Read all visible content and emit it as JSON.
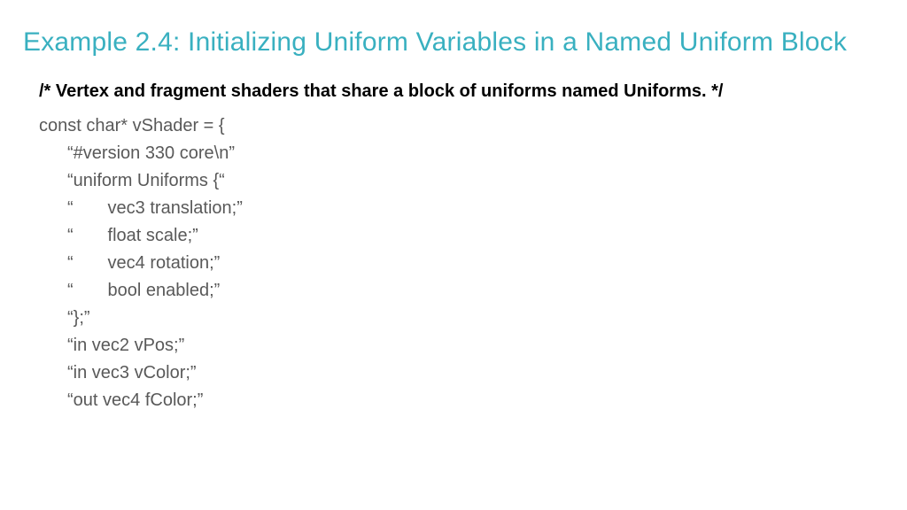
{
  "title": "Example 2.4:  Initializing Uniform Variables in a Named Uniform Block",
  "comment": "/* Vertex and fragment shaders that share a block of uniforms named Uniforms. */",
  "code": {
    "l0": "const char* vShader = {",
    "l1": "“#version 330 core\\n”",
    "l2": "“uniform Uniforms {“",
    "l3": "“       vec3 translation;”",
    "l4": "“       float scale;”",
    "l5": "“       vec4 rotation;”",
    "l6": "“       bool enabled;”",
    "l7": "“};”",
    "l8": "“in vec2 vPos;”",
    "l9": "“in vec3 vColor;”",
    "l10": "“out vec4 fColor;”"
  }
}
